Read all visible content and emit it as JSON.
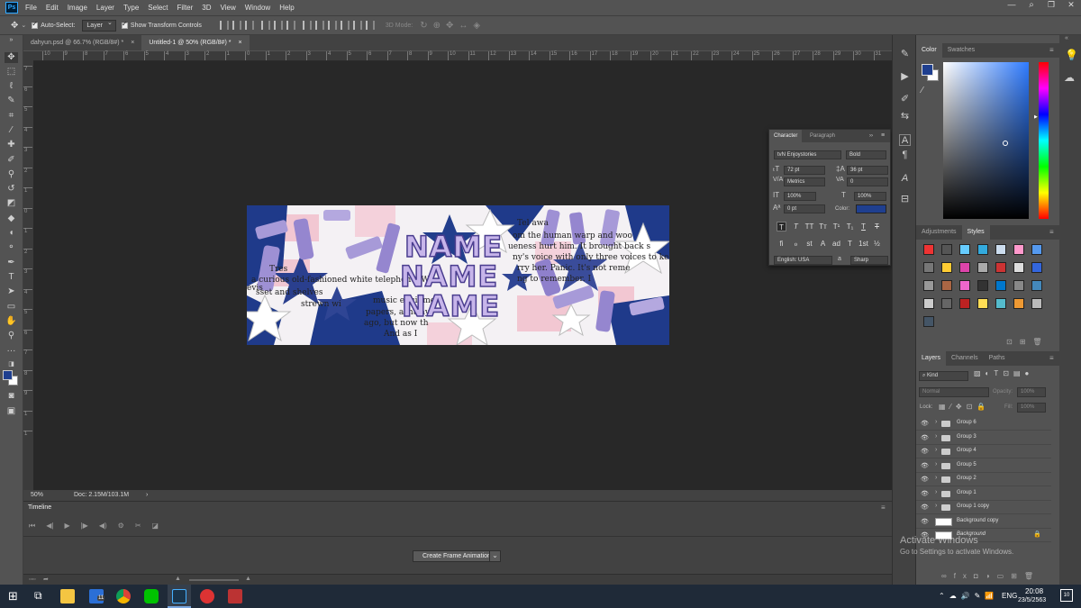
{
  "menubar": {
    "app_badge": "Ps",
    "items": [
      "File",
      "Edit",
      "Image",
      "Layer",
      "Type",
      "Select",
      "Filter",
      "3D",
      "View",
      "Window",
      "Help"
    ],
    "min": "—",
    "max": "❐",
    "close": "✕"
  },
  "options": {
    "auto_select": "Auto-Select:",
    "auto_select_target": "Layer",
    "show_transform": "Show Transform Controls",
    "mode3d": "3D Mode:"
  },
  "tabs": [
    {
      "label": "dahyun.psd @ 66.7% (RGB/8#) *",
      "close": "×"
    },
    {
      "label": "Untitled-1 @ 50% (RGB/8#) *",
      "close": "×"
    }
  ],
  "ruler": {
    "top": [
      "10",
      "9",
      "8",
      "7",
      "6",
      "5",
      "4",
      "3",
      "2",
      "1",
      "0",
      "1",
      "2",
      "3",
      "4",
      "5",
      "6",
      "7",
      "8",
      "9",
      "10",
      "11",
      "12",
      "13",
      "14",
      "15",
      "16",
      "17",
      "18",
      "19",
      "20",
      "21",
      "22",
      "23",
      "24",
      "25",
      "26",
      "27",
      "28",
      "29",
      "30",
      "31"
    ],
    "left": [
      "7",
      "6",
      "5",
      "4",
      "3",
      "2",
      "1",
      "0",
      "1",
      "2",
      "3",
      "4",
      "5",
      "6",
      "7",
      "8",
      "9",
      "1",
      "1"
    ]
  },
  "artwork": {
    "name_lines": [
      "NAME",
      "NAME",
      "NAME"
    ],
    "book_text": [
      "Tel awa",
      "om the human warp and woo",
      "ueness hurt him. It brought back s",
      "ny's voice with only three voices to ke",
      "rry her. Panic. It's not reme",
      "ng to remember. I",
      "a curious old-fashioned white telephone. Wi",
      "sset and shelves",
      "music equipmen",
      "strewn wi",
      "papers, ashtrays",
      "ago, but now th",
      "And as I",
      "Tres",
      "evis"
    ]
  },
  "status": {
    "zoom": "50%",
    "doc": "Doc: 2.15M/103.1M",
    "arrow": "›"
  },
  "timeline": {
    "title": "Timeline",
    "controls": [
      "⏮",
      "◀|",
      "▶",
      "|▶",
      "◀)",
      "⚙",
      "✂",
      "◪"
    ],
    "create_label": "Create Frame Animation",
    "create_dropdown": "⌄"
  },
  "character": {
    "tabs": [
      "Character",
      "Paragraph"
    ],
    "font_family": "tvN Enjoystories",
    "font_style": "Bold",
    "font_size": "72 pt",
    "leading": "36 pt",
    "kerning": "Metrics",
    "tracking": "0",
    "vscale": "100%",
    "hscale": "100%",
    "baseline": "0 pt",
    "color_label": "Color:",
    "color": "#1f3f8f",
    "language": "English: USA",
    "aa_label": "a",
    "antialias": "Sharp",
    "glyphs_row1": [
      "T",
      "T",
      "TT",
      "Tт",
      "T¹",
      "T₁",
      "T",
      "T"
    ],
    "glyphs_row2": [
      "fi",
      "ℴ",
      "st",
      "A",
      "ad",
      "T",
      "1st",
      "½"
    ]
  },
  "color_panel": {
    "tabs": [
      "Color",
      "Swatches"
    ],
    "fg": "#1f3f8f",
    "bg": "#ffffff"
  },
  "adjustments": {
    "tabs": [
      "Adjustments",
      "Styles"
    ]
  },
  "layers": {
    "tabs": [
      "Layers",
      "Channels",
      "Paths"
    ],
    "kind": "Kind",
    "blend": "Normal",
    "opacity_label": "Opacity:",
    "opacity": "100%",
    "lock_label": "Lock:",
    "fill_label": "Fill:",
    "fill": "100%",
    "items": [
      {
        "name": "Group 6",
        "type": "group"
      },
      {
        "name": "Group 3",
        "type": "group"
      },
      {
        "name": "Group 4",
        "type": "group"
      },
      {
        "name": "Group 5",
        "type": "group"
      },
      {
        "name": "Group 2",
        "type": "group"
      },
      {
        "name": "Group 1",
        "type": "group"
      },
      {
        "name": "Group 1 copy",
        "type": "group"
      },
      {
        "name": "Background copy",
        "type": "layer"
      },
      {
        "name": "Background",
        "type": "layer"
      }
    ]
  },
  "watermark": {
    "title": "Activate Windows",
    "subtitle": "Go to Settings to activate Windows."
  },
  "taskbar": {
    "time": "20:08",
    "date": "23/5/2563",
    "lang": "ENG",
    "badge": "11",
    "notif": "10"
  }
}
